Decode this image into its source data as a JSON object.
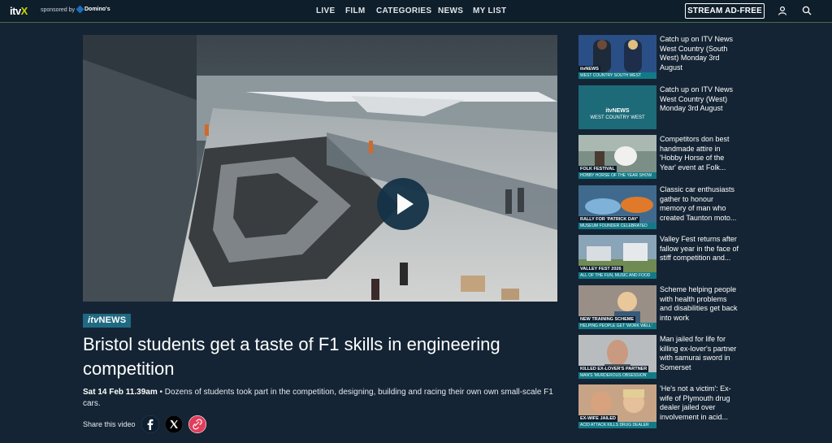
{
  "header": {
    "logo_main": "itv",
    "logo_x": "X",
    "sponsored_by": "sponsored by",
    "sponsor_name": "Domino's",
    "nav": [
      "LIVE",
      "FILM",
      "CATEGORIES",
      "NEWS",
      "MY LIST"
    ],
    "stream_button": "STREAM AD-FREE"
  },
  "article": {
    "badge_itv": "itv",
    "badge_news": "NEWS",
    "title": "Bristol students get a taste of F1 skills in engineering competition",
    "date": "Sat 14 Feb 11.39am",
    "summary": " • Dozens of students took part in the competition, designing, building and racing their own own small-scale F1 cars.",
    "share_label": "Share this video"
  },
  "sidebar": {
    "items": [
      {
        "text": "Catch up on ITV News West Country (South West) Monday 3rd August",
        "thumb_l1": "itvNEWS",
        "thumb_l2": "WEST COUNTRY SOUTH WEST",
        "thumb_color": "#2a4f86"
      },
      {
        "text": "Catch up on ITV News West Country (West) Monday 3rd August",
        "thumb_l1": "itvNEWS",
        "thumb_l2": "WEST COUNTRY WEST",
        "thumb_color": "#1d6a78"
      },
      {
        "text": "Competitors don best handmade attire in 'Hobby Horse of the Year' event at Folk...",
        "thumb_l1": "FOLK FESTIVAL",
        "thumb_l2": "HOBBY HORSE OF THE YEAR SHOW",
        "thumb_color": "#7b8f86"
      },
      {
        "text": "Classic car enthusiasts gather to honour memory of man who created Taunton moto...",
        "thumb_l1": "RALLY FOR 'PATRICK DAY'",
        "thumb_l2": "MUSEUM FOUNDER CELEBRATED",
        "thumb_color": "#3f6a8e"
      },
      {
        "text": "Valley Fest returns after fallow year in the face of stiff competition and...",
        "thumb_l1": "VALLEY FEST 2026",
        "thumb_l2": "ALL OF THE FUN, MUSIC AND FOOD",
        "thumb_color": "#8aa4b8"
      },
      {
        "text": "Scheme helping people with health problems and disabilities get back into work",
        "thumb_l1": "NEW TRAINING SCHEME",
        "thumb_l2": "HELPING PEOPLE GET 'WORK WELL'",
        "thumb_color": "#9a8f86"
      },
      {
        "text": "Man jailed for life for killing ex-lover's partner with samurai sword in Somerset",
        "thumb_l1": "KILLED EX-LOVER'S PARTNER",
        "thumb_l2": "MAN'S 'MURDEROUS OBSESSION'",
        "thumb_color": "#b9bcbf"
      },
      {
        "text": "'He's not a victim': Ex-wife of Plymouth drug dealer jailed over involvement in acid...",
        "thumb_l1": "EX-WIFE JAILED",
        "thumb_l2": "ACID ATTACK KILLS DRUG DEALER",
        "thumb_color": "#c8a487"
      }
    ]
  },
  "colors": {
    "background": "#142434",
    "header": "#0f1e2b",
    "accent": "#c9d400",
    "badge": "#1f6a82",
    "play_button": "#143247"
  }
}
